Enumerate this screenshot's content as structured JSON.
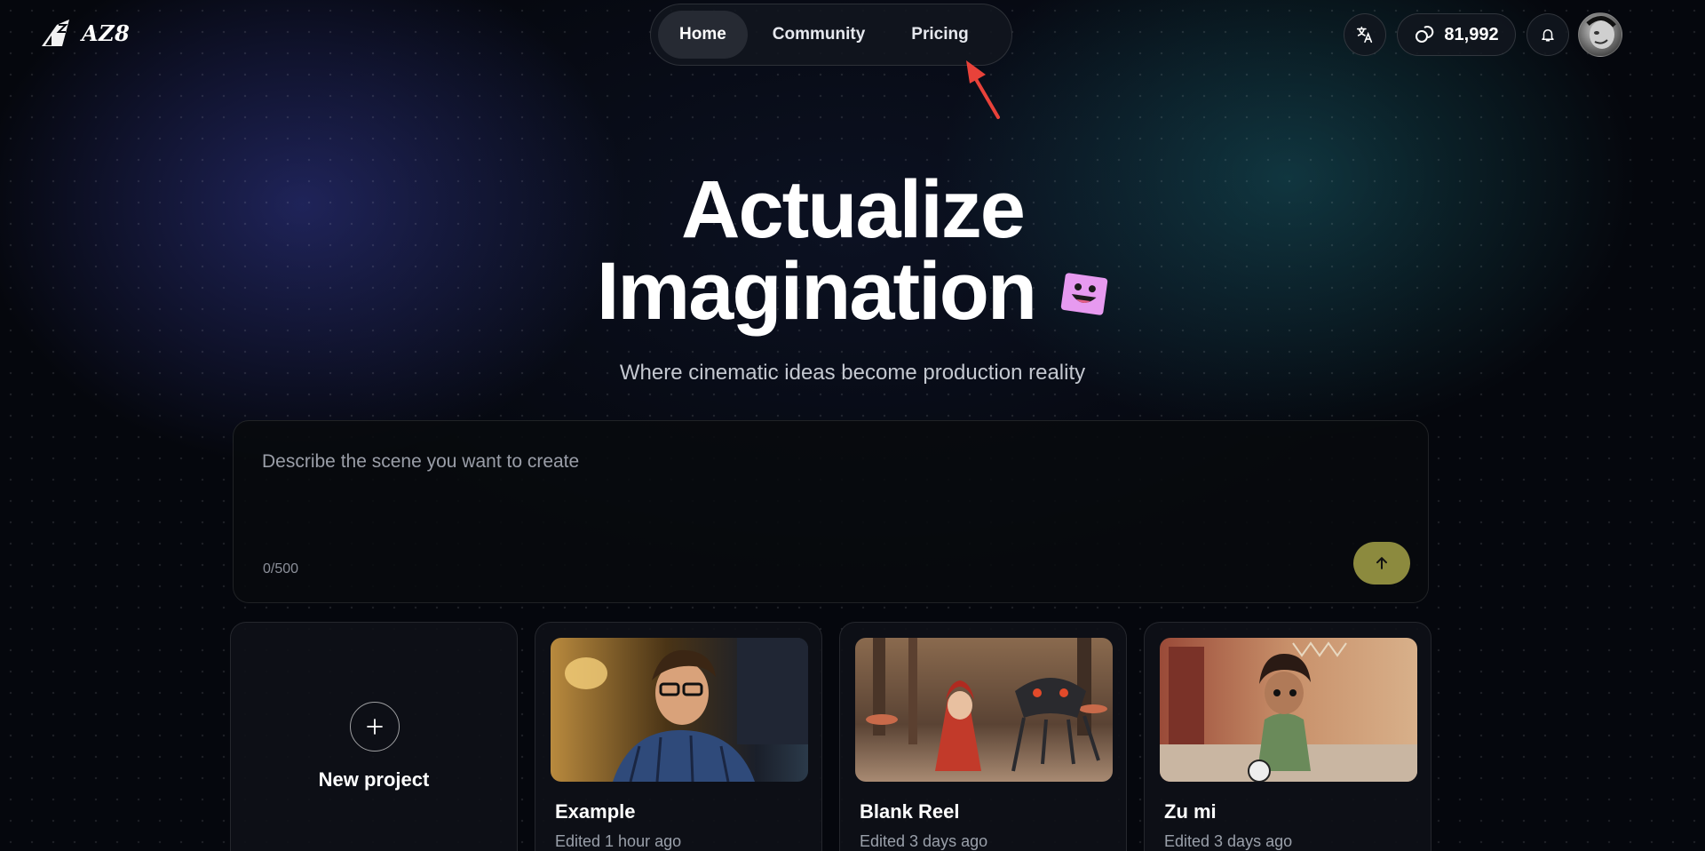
{
  "brand": {
    "name": "AZ8",
    "icon": "az8-logo-icon"
  },
  "nav": {
    "items": [
      {
        "label": "Home",
        "active": true
      },
      {
        "label": "Community",
        "active": false
      },
      {
        "label": "Pricing",
        "active": false
      }
    ]
  },
  "header": {
    "translate_icon": "translate-icon",
    "credits": {
      "icon": "credits-coin-icon",
      "value": "81,992"
    },
    "bell_icon": "bell-icon"
  },
  "hero": {
    "title_line1": "Actualize",
    "title_line2": "Imagination",
    "subtitle": "Where cinematic ideas become production reality"
  },
  "prompt": {
    "placeholder": "Describe the scene you want to create",
    "value": "",
    "char_count": "0/500",
    "send_icon": "arrow-up-icon",
    "send_color": "#8c8a3e"
  },
  "projects": {
    "new_label": "New project",
    "items": [
      {
        "title": "Example",
        "edited": "Edited 1 hour ago"
      },
      {
        "title": "Blank Reel",
        "edited": "Edited 3 days ago"
      },
      {
        "title": "Zu mi",
        "edited": "Edited 3 days ago"
      }
    ]
  },
  "colors": {
    "accent": "#8c8a3e",
    "annotation_arrow": "#e8423a",
    "background": "#05070d"
  }
}
